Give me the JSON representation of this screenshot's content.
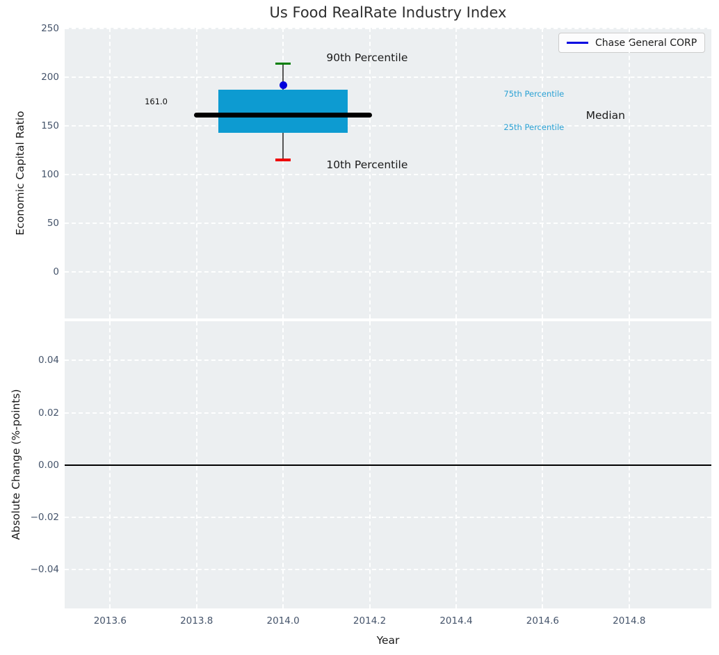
{
  "colors": {
    "axes_bg": "#ECEFF1",
    "grid": "#FFFFFF",
    "box_fill": "#0D9BD1",
    "median_line": "#000000",
    "whisker": "#555555",
    "cap_90th": "#007E00",
    "cap_10th": "#EE0000",
    "company_dot": "#0000DC",
    "legend_line": "#0000E0",
    "percentile_text": "#2AA1D4",
    "tick_label": "#44536A",
    "title": "#2D2D2D"
  },
  "chart_data": [
    {
      "type": "boxplot",
      "title": "Us Food RealRate Industry Index",
      "ylabel": "Economic Capital Ratio",
      "legend": [
        "Chase General CORP"
      ],
      "legend_position": "upper-right",
      "grid": "white-dashed",
      "x": 2014.0,
      "stats": {
        "p10": 115,
        "q1": 143,
        "median": 161.0,
        "q3": 187,
        "p90": 214
      },
      "company_value": 192,
      "median_value_label": "161.0",
      "box_halfwidth": 0.15,
      "median_halfwidth": 0.2,
      "cap_halfwidth": 0.018,
      "xlim": [
        2013.495,
        2014.99
      ],
      "ylim": [
        -48,
        251
      ],
      "xticks": [
        2013.6,
        2013.8,
        2014.0,
        2014.2,
        2014.4,
        2014.6,
        2014.8
      ],
      "yticks": [
        0,
        50,
        100,
        150,
        200,
        250
      ],
      "ytick_labels": [
        "0",
        "50",
        "100",
        "150",
        "200",
        "250"
      ],
      "annotations": [
        {
          "name": "label-90th-percentile",
          "text": "90th Percentile",
          "x": 2014.1,
          "y": 220,
          "style": "large-dark"
        },
        {
          "name": "label-10th-percentile",
          "text": "10th Percentile",
          "x": 2014.1,
          "y": 110,
          "style": "large-dark"
        },
        {
          "name": "label-75th-percentile",
          "text": "75th Percentile",
          "x": 2014.51,
          "y": 183,
          "style": "small-cyan"
        },
        {
          "name": "label-25th-percentile",
          "text": "25th Percentile",
          "x": 2014.51,
          "y": 149,
          "style": "small-cyan"
        },
        {
          "name": "label-median",
          "text": "Median",
          "x": 2014.7,
          "y": 161,
          "style": "large-dark"
        },
        {
          "name": "label-median-value",
          "text": "161.0",
          "x": 2013.68,
          "y": 175,
          "style": "small-dark"
        }
      ]
    },
    {
      "type": "line",
      "ylabel": "Absolute Change (%-points)",
      "xlabel": "Year",
      "grid": "white-dashed",
      "series": [],
      "zero_line": 0.0,
      "xlim": [
        2013.495,
        2014.99
      ],
      "ylim": [
        -0.0548,
        0.055
      ],
      "xticks": [
        2013.6,
        2013.8,
        2014.0,
        2014.2,
        2014.4,
        2014.6,
        2014.8
      ],
      "xtick_labels": [
        "2013.6",
        "2013.8",
        "2014.0",
        "2014.2",
        "2014.4",
        "2014.6",
        "2014.8"
      ],
      "yticks": [
        -0.04,
        -0.02,
        0.0,
        0.02,
        0.04
      ],
      "ytick_labels": [
        "−0.04",
        "−0.02",
        "0.00",
        "0.02",
        "0.04"
      ]
    }
  ]
}
